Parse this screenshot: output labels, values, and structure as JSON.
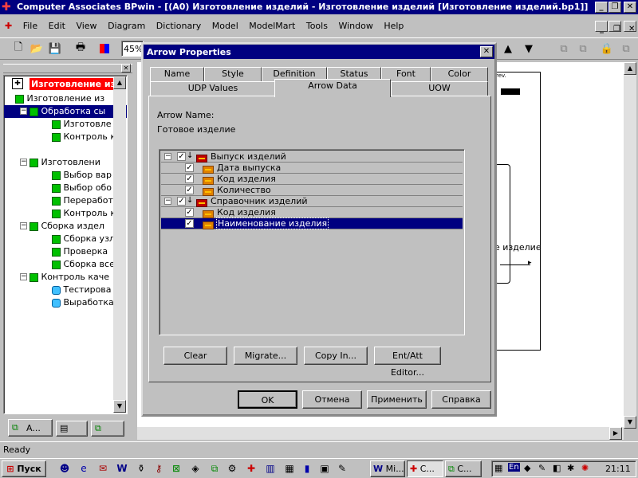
{
  "app": {
    "title": "Computer Associates BPwin - [(A0) Изготовление изделий - Изготовление изделий  [Изготовление изделий.bp1]]",
    "menu": [
      "File",
      "Edit",
      "View",
      "Diagram",
      "Dictionary",
      "Model",
      "ModelMart",
      "Tools",
      "Window",
      "Help"
    ],
    "zoom": "45%",
    "status": "Ready"
  },
  "tree": {
    "root": "Изготовление изд",
    "items": [
      {
        "label": "Изготовление из",
        "level": 1
      },
      {
        "label": "Обработка  сы",
        "level": 2,
        "selected": true
      },
      {
        "label": "Изготовле",
        "level": 3
      },
      {
        "label": "Контроль к",
        "level": 3
      },
      {
        "label": "Изготовлени",
        "level": 2
      },
      {
        "label": "Выбор  вар",
        "level": 3
      },
      {
        "label": "Выбор  обо",
        "level": 3
      },
      {
        "label": "Переработ",
        "level": 3
      },
      {
        "label": "Контроль к",
        "level": 3
      },
      {
        "label": "Сборка издел",
        "level": 2
      },
      {
        "label": "Сборка узл",
        "level": 3
      },
      {
        "label": "Проверка ",
        "level": 3
      },
      {
        "label": "Сборка все",
        "level": 3
      },
      {
        "label": "Контроль каче",
        "level": 2
      },
      {
        "label": "Тестирова",
        "level": 3,
        "cyan": true
      },
      {
        "label": "Выработка",
        "level": 3,
        "cyan": true
      }
    ],
    "bottom_tabs": [
      "A..."
    ]
  },
  "dialog": {
    "title": "Arrow Properties",
    "tabs_row1": [
      "Name",
      "Style",
      "Definition",
      "Status",
      "Font",
      "Color"
    ],
    "tabs_row2": [
      "UDP Values",
      "Arrow Data",
      "UOW"
    ],
    "active_tab": "Arrow Data",
    "arrow_name_label": "Arrow Name:",
    "arrow_name_value": "Готовое изделие",
    "data_tree": [
      {
        "label": "Выпуск изделий",
        "type": "entity"
      },
      {
        "label": "Дата выпуска",
        "type": "attribute"
      },
      {
        "label": "Код изделия",
        "type": "attribute"
      },
      {
        "label": "Количество",
        "type": "attribute"
      },
      {
        "label": "Справочник изделий",
        "type": "entity"
      },
      {
        "label": "Код изделия",
        "type": "attribute"
      },
      {
        "label": "Наименование изделия",
        "type": "attribute",
        "selected": true
      }
    ],
    "buttons": {
      "clear": "Clear",
      "migrate": "Migrate...",
      "copy_in": "Copy In...",
      "ent_att": "Ent/Att Editor...",
      "ok": "OK",
      "cancel": "Отмена",
      "apply": "Применить",
      "help": "Справка"
    }
  },
  "canvas": {
    "header_fragment": "rev.",
    "arrow_label": "е изделие"
  },
  "taskbar": {
    "start": "Пуск",
    "tasks": [
      "Mi...",
      "C...",
      "C..."
    ],
    "lang": "En",
    "time": "21:11"
  }
}
